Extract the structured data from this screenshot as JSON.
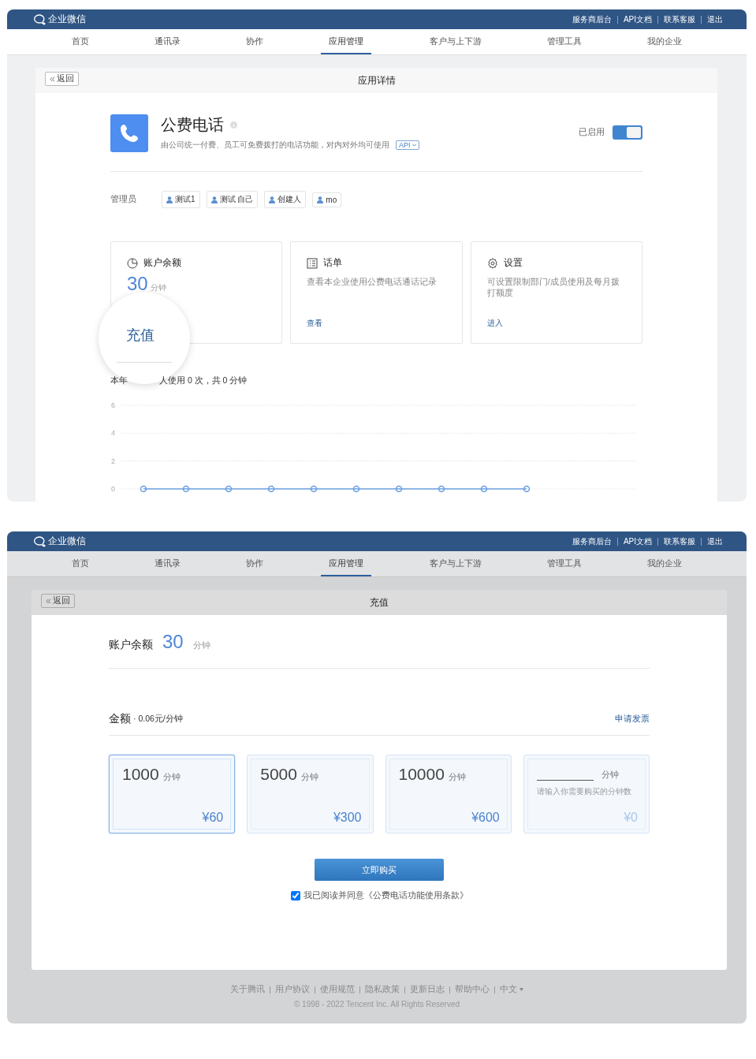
{
  "screen_1": {
    "brand": "企业微信",
    "top_links": [
      "服务商后台",
      "API文档",
      "联系客服",
      "退出"
    ],
    "nav": [
      {
        "label": "首页",
        "selected": false
      },
      {
        "label": "通讯录",
        "selected": false
      },
      {
        "label": "协作",
        "selected": false
      },
      {
        "label": "应用管理",
        "selected": true
      },
      {
        "label": "客户与上下游",
        "selected": false
      },
      {
        "label": "管理工具",
        "selected": false
      },
      {
        "label": "我的企业",
        "selected": false
      }
    ],
    "back_button": "返回",
    "panel_title": "应用详情",
    "app": {
      "name": "公费电话",
      "description": "由公司统一付费、员工可免费拨打的电话功能，对内对外均可使用",
      "api_tag": "API",
      "status_label": "已启用",
      "enabled": true
    },
    "admins_label": "管理员",
    "admins": [
      "测试1",
      "测试 自己",
      "创建人",
      "mo"
    ],
    "cards": [
      {
        "kind": "balance",
        "title": "账户余额",
        "value": "30",
        "unit": "分钟"
      },
      {
        "kind": "records",
        "title": "话单",
        "description": "查看本企业使用公费电话通话记录",
        "link": "查看"
      },
      {
        "kind": "settings",
        "title": "设置",
        "description": "可设置限制部门/成员使用及每月拨打额度",
        "link": "进入"
      }
    ],
    "magnifier_text": "充值",
    "usage_text_parts": [
      "本年",
      "人使用 0 次，共 0 分钟"
    ],
    "chart_data": {
      "type": "line",
      "ylim": [
        0,
        6
      ],
      "yticks": [
        0,
        2,
        4,
        6
      ],
      "series": [
        {
          "color": "#6a9fe0",
          "marker": "circle",
          "values": [
            0,
            0,
            0,
            0,
            0,
            0,
            0,
            0,
            0,
            0
          ]
        }
      ]
    }
  },
  "screen_2": {
    "brand": "企业微信",
    "top_links": [
      "服务商后台",
      "API文档",
      "联系客服",
      "退出"
    ],
    "nav": [
      {
        "label": "首页",
        "selected": false
      },
      {
        "label": "通讯录",
        "selected": false
      },
      {
        "label": "协作",
        "selected": false
      },
      {
        "label": "应用管理",
        "selected": true
      },
      {
        "label": "客户与上下游",
        "selected": false
      },
      {
        "label": "管理工具",
        "selected": false
      },
      {
        "label": "我的企业",
        "selected": false
      }
    ],
    "back_button": "返回",
    "panel_title": "充值",
    "balance_label": "账户余额",
    "balance_value": "30",
    "balance_unit": "分钟",
    "amount_label": "金额",
    "rate": "· 0.06元/分钟",
    "invoice_link": "申请发票",
    "packages": [
      {
        "kind": "fixed",
        "minutes": "1000",
        "unit": "分钟",
        "price": "¥60",
        "selected": true
      },
      {
        "kind": "fixed",
        "minutes": "5000",
        "unit": "分钟",
        "price": "¥300",
        "selected": false
      },
      {
        "kind": "fixed",
        "minutes": "10000",
        "unit": "分钟",
        "price": "¥600",
        "selected": false
      },
      {
        "kind": "custom",
        "unit": "分钟",
        "hint": "请输入你需要购买的分钟数",
        "price": "¥0",
        "selected": false
      }
    ],
    "buy_button": "立即购买",
    "agreement": {
      "checked": true,
      "text": "我已阅读并同意《公费电话功能使用条款》"
    },
    "footer_links": [
      "关于腾讯",
      "用户协议",
      "使用规范",
      "隐私政策",
      "更新日志",
      "帮助中心"
    ],
    "language": "中文",
    "copyright": "© 1998 - 2022 Tencent Inc. All Rights Reserved"
  }
}
